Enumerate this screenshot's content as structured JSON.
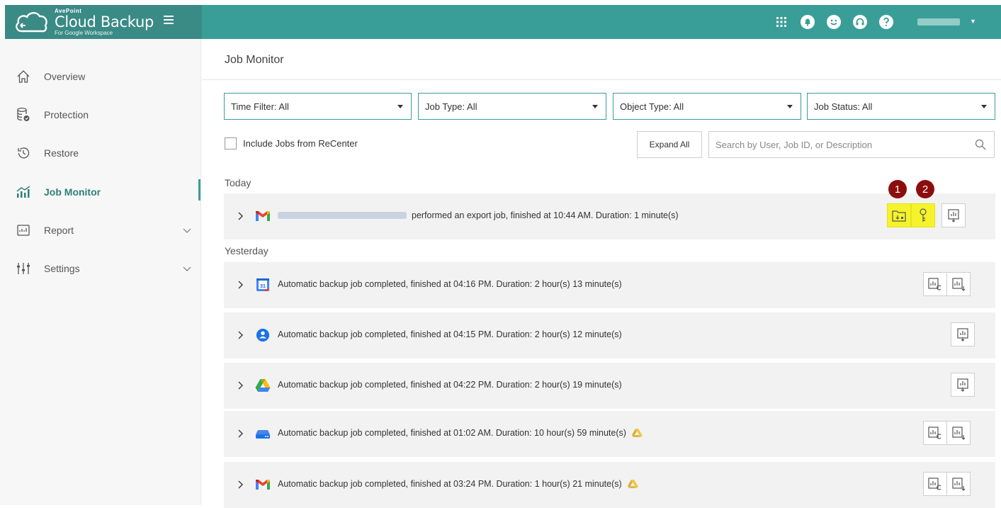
{
  "header": {
    "vendor": "AvePoint",
    "product": "Cloud Backup",
    "product_sub": "For Google Workspace",
    "icons": [
      "apps-grid-icon",
      "notification-bell-icon",
      "feedback-smile-icon",
      "support-headset-icon",
      "help-question-icon"
    ],
    "brand_color": "#3a8a86",
    "bar_color": "#3a9e98"
  },
  "sidebar": {
    "items": [
      {
        "label": "Overview",
        "icon": "home-icon"
      },
      {
        "label": "Protection",
        "icon": "database-shield-icon"
      },
      {
        "label": "Restore",
        "icon": "history-icon"
      },
      {
        "label": "Job Monitor",
        "icon": "chart-icon",
        "active": true
      },
      {
        "label": "Report",
        "icon": "report-icon",
        "expandable": true
      },
      {
        "label": "Settings",
        "icon": "sliders-icon",
        "expandable": true
      }
    ]
  },
  "main": {
    "title": "Job Monitor",
    "filters": [
      "Time Filter: All",
      "Job Type: All",
      "Object Type: All",
      "Job Status: All"
    ],
    "include_recenter_label": "Include Jobs from ReCenter",
    "expand_all_label": "Expand All",
    "search_placeholder": "Search by User, Job ID, or Description",
    "sections": {
      "today": "Today",
      "yesterday": "Yesterday"
    },
    "jobs": [
      {
        "service": "gmail",
        "text": "performed an export job, finished at 10:44 AM. Duration: 1 minute(s)"
      },
      {
        "service": "calendar",
        "text": "Automatic backup job completed, finished at 04:16 PM. Duration: 2 hour(s) 13 minute(s)"
      },
      {
        "service": "contacts",
        "text": "Automatic backup job completed, finished at 04:15 PM. Duration: 2 hour(s) 12 minute(s)"
      },
      {
        "service": "drive",
        "text": "Automatic backup job completed, finished at 04:22 PM. Duration: 2 hour(s) 19 minute(s)"
      },
      {
        "service": "shared-drive",
        "text": "Automatic backup job completed, finished at 01:02 AM. Duration: 10 hour(s) 59 minute(s)",
        "warning": true
      },
      {
        "service": "gmail",
        "text": "Automatic backup job completed, finished at 03:24 PM. Duration: 1 hour(s) 21 minute(s)",
        "warning": true
      }
    ],
    "callouts": [
      "1",
      "2"
    ],
    "highlight_color": "#f5f32c",
    "callout_color": "#8b0d0d"
  }
}
